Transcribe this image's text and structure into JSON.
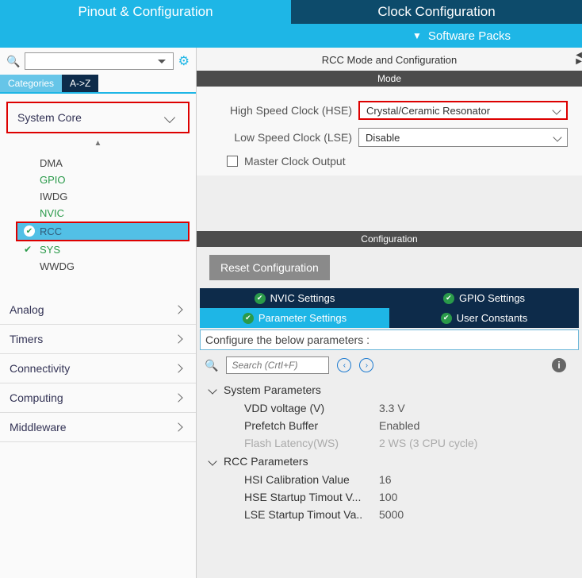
{
  "tabs": {
    "pinout": "Pinout & Configuration",
    "clock": "Clock Configuration"
  },
  "swPacks": "Software Packs",
  "sidebar": {
    "catTab": "Categories",
    "azTab": "A->Z",
    "systemCore": "System Core",
    "tree": [
      "DMA",
      "GPIO",
      "IWDG",
      "NVIC",
      "RCC",
      "SYS",
      "WWDG"
    ],
    "groups": [
      "Analog",
      "Timers",
      "Connectivity",
      "Computing",
      "Middleware"
    ]
  },
  "content": {
    "title": "RCC Mode and Configuration",
    "modeBar": "Mode",
    "hseLabel": "High Speed Clock (HSE)",
    "hseValue": "Crystal/Ceramic Resonator",
    "lseLabel": "Low Speed Clock (LSE)",
    "lseValue": "Disable",
    "masterClock": "Master Clock Output",
    "configBar": "Configuration",
    "resetBtn": "Reset Configuration",
    "tabs": [
      "NVIC Settings",
      "GPIO Settings",
      "Parameter Settings",
      "User Constants"
    ],
    "paramDesc": "Configure the below parameters :",
    "searchPlaceholder": "Search (CrtI+F)",
    "sysParams": {
      "title": "System Parameters",
      "items": [
        {
          "label": "VDD voltage (V)",
          "value": "3.3 V"
        },
        {
          "label": "Prefetch Buffer",
          "value": "Enabled"
        },
        {
          "label": "Flash Latency(WS)",
          "value": "2 WS (3 CPU cycle)"
        }
      ]
    },
    "rccParams": {
      "title": "RCC Parameters",
      "items": [
        {
          "label": "HSI Calibration Value",
          "value": "16"
        },
        {
          "label": "HSE Startup Timout V...",
          "value": "100"
        },
        {
          "label": "LSE Startup Timout Va..",
          "value": "5000"
        }
      ]
    }
  }
}
